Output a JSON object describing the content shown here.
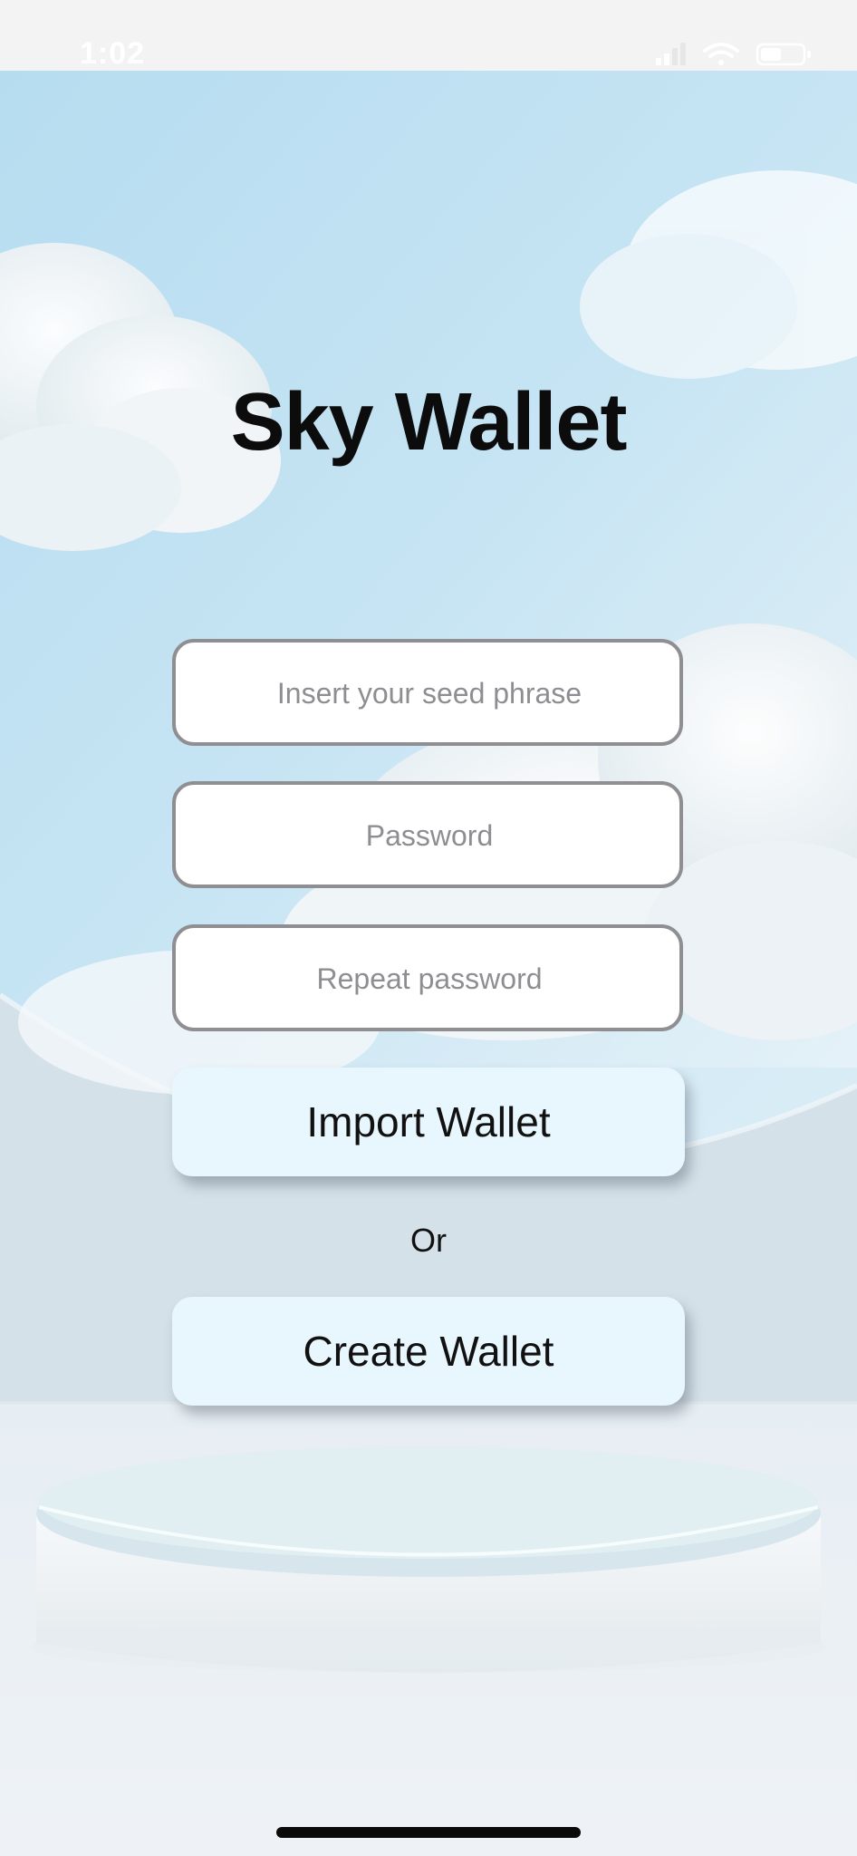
{
  "status_bar": {
    "time": "1:02"
  },
  "app": {
    "title": "Sky Wallet"
  },
  "form": {
    "seed_placeholder": "Insert your seed phrase",
    "password_placeholder": "Password",
    "repeat_password_placeholder": "Repeat password",
    "import_label": "Import Wallet",
    "or_label": "Or",
    "create_label": "Create Wallet"
  },
  "colors": {
    "sky": "#cfe5f2",
    "button_bg": "#e8f6fd",
    "field_border": "#8f8f93"
  }
}
